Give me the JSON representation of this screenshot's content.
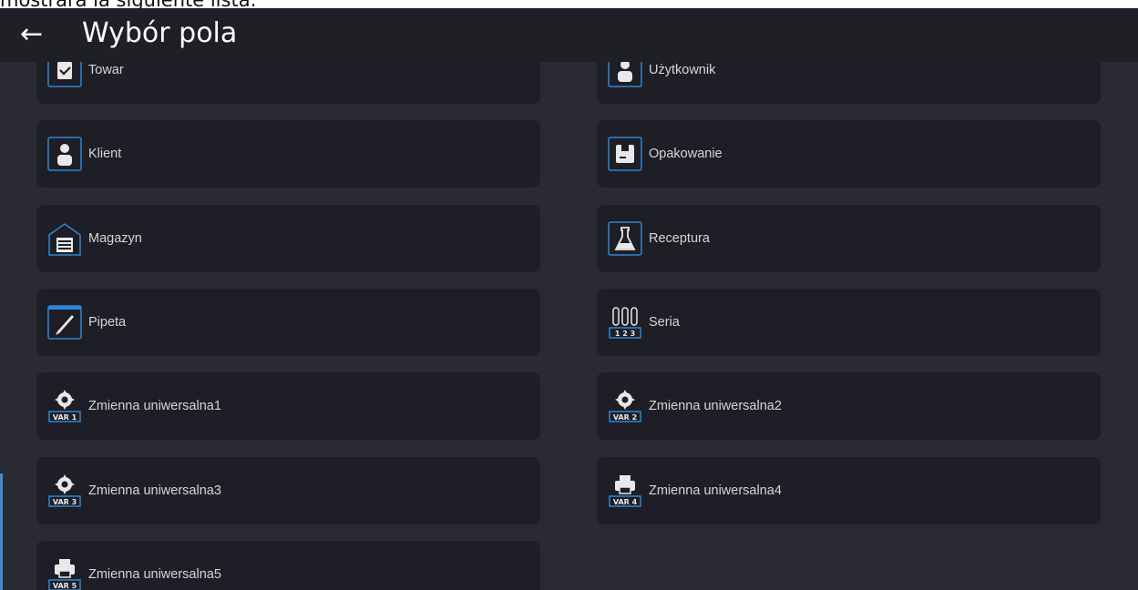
{
  "caption_fragment": "mostrará la siguiente lista:",
  "header": {
    "back_icon": "arrow-left-icon",
    "title": "Wybór pola"
  },
  "colors": {
    "background": "#2a2a33",
    "tile": "#1e1e26",
    "accent": "#2f86d3"
  },
  "fields": [
    {
      "label": "Towar",
      "icon": "clipboard-check-icon"
    },
    {
      "label": "Użytkownik",
      "icon": "user-icon"
    },
    {
      "label": "Klient",
      "icon": "client-icon"
    },
    {
      "label": "Opakowanie",
      "icon": "package-icon"
    },
    {
      "label": "Magazyn",
      "icon": "warehouse-icon"
    },
    {
      "label": "Receptura",
      "icon": "flask-icon"
    },
    {
      "label": "Pipeta",
      "icon": "pipette-icon"
    },
    {
      "label": "Seria",
      "icon": "test-tubes-icon",
      "icon_text": "1 2 3"
    },
    {
      "label": "Zmienna uniwersalna1",
      "icon": "gear-var-icon",
      "icon_text": "VAR 1"
    },
    {
      "label": "Zmienna uniwersalna2",
      "icon": "gear-var-icon",
      "icon_text": "VAR 2"
    },
    {
      "label": "Zmienna uniwersalna3",
      "icon": "gear-var-icon",
      "icon_text": "VAR 3"
    },
    {
      "label": "Zmienna uniwersalna4",
      "icon": "printer-var-icon",
      "icon_text": "VAR 4"
    },
    {
      "label": "Zmienna uniwersalna5",
      "icon": "printer-var-icon",
      "icon_text": "VAR 5"
    }
  ]
}
